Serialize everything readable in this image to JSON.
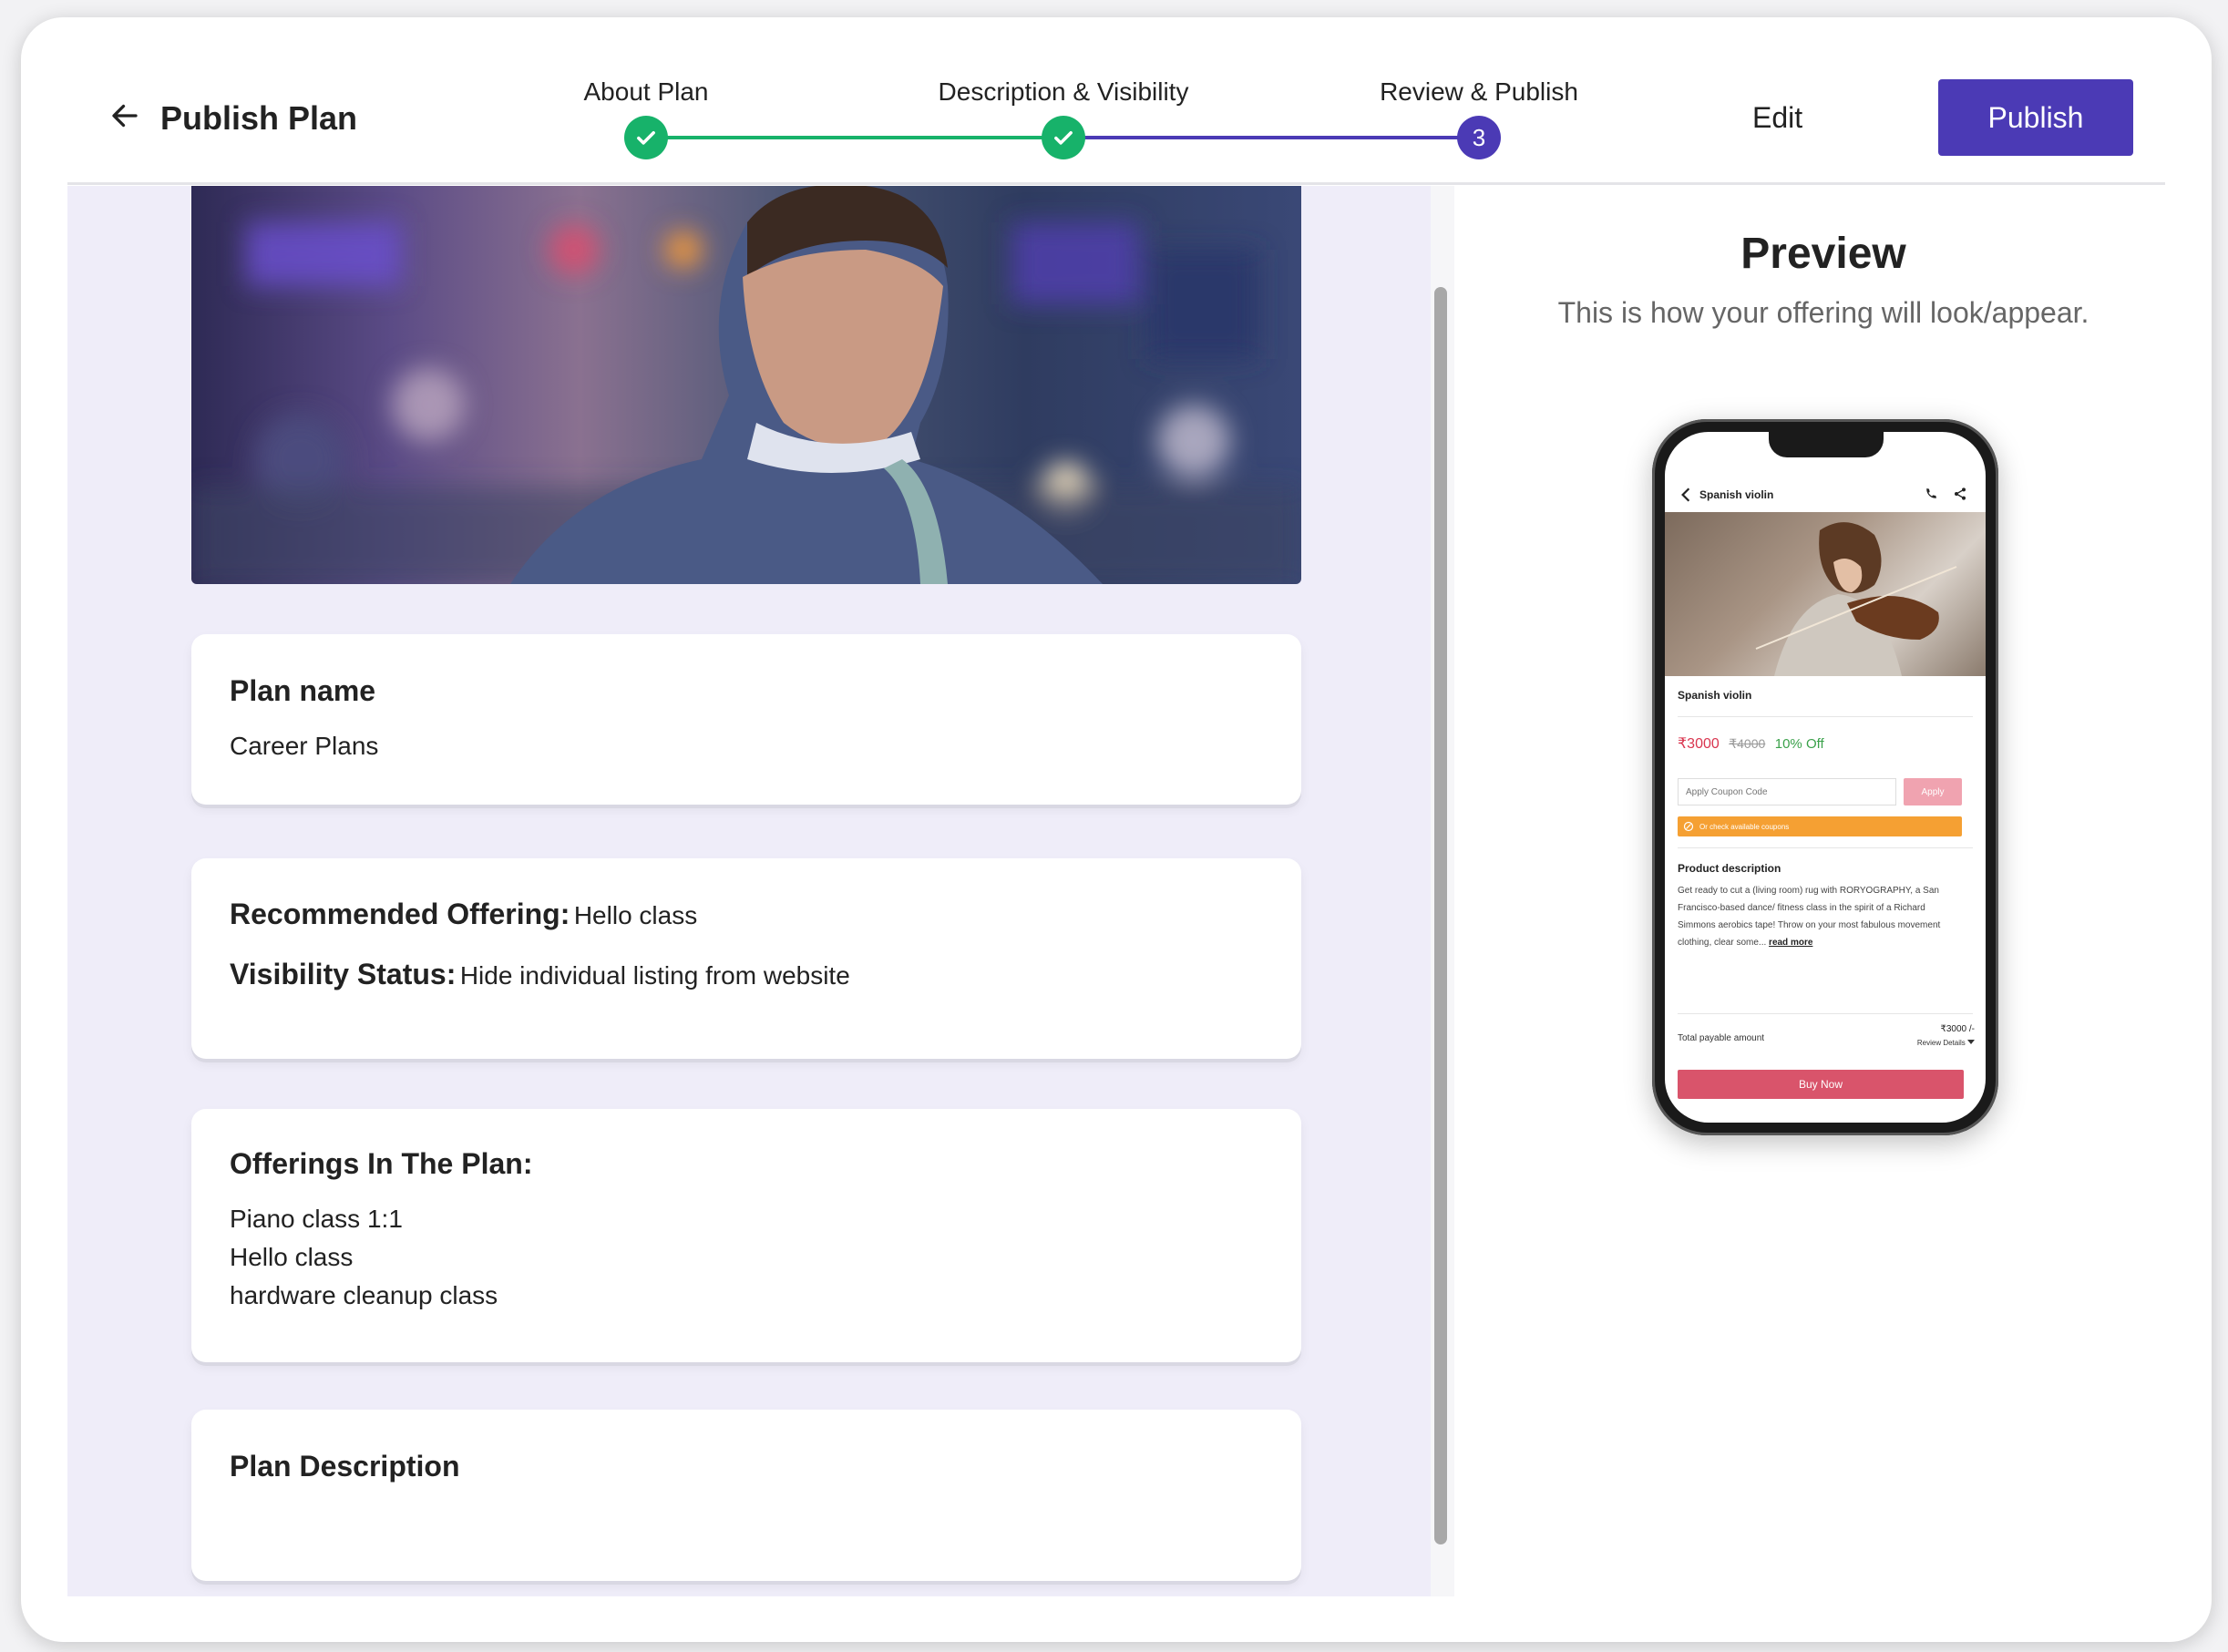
{
  "header": {
    "title": "Publish Plan",
    "steps": [
      {
        "label": "About Plan",
        "status": "done"
      },
      {
        "label": "Description & Visibility",
        "status": "done"
      },
      {
        "label": "Review & Publish",
        "status": "current",
        "number": "3"
      }
    ],
    "edit_label": "Edit",
    "publish_label": "Publish"
  },
  "cards": {
    "plan_name": {
      "title": "Plan name",
      "value": "Career Plans"
    },
    "details": {
      "recommended_label": "Recommended Offering:",
      "recommended_value": "Hello class",
      "visibility_label": "Visibility Status:",
      "visibility_value": "Hide individual listing from website"
    },
    "offerings": {
      "title": "Offerings In The Plan:",
      "items": [
        "Piano class 1:1",
        "Hello class",
        "hardware cleanup class"
      ]
    },
    "description": {
      "title": "Plan Description"
    }
  },
  "preview": {
    "title": "Preview",
    "subtitle": "This is how your offering will look/appear.",
    "phone": {
      "topbar_title": "Spanish violin",
      "product_name": "Spanish violin",
      "price": "₹3000",
      "old_price": "₹4000",
      "discount": "10% Off",
      "coupon_placeholder": "Apply Coupon Code",
      "apply_label": "Apply",
      "coupons_banner": "Or check available coupons",
      "desc_title": "Product description",
      "desc_text": "Get ready to cut a (living room) rug with RORYOGRAPHY, a San Francisco-based dance/ fitness class in the spirit of a Richard Simmons aerobics tape! Throw on your most fabulous movement clothing, clear some...",
      "read_more": "read more",
      "total_label": "Total payable amount",
      "total_value": "₹3000 /-",
      "review_details": "Review Details",
      "buy_now": "Buy Now"
    }
  },
  "colors": {
    "primary": "#4b3ab5",
    "success": "#17b26a",
    "panel_bg": "#efedf9",
    "buy_button": "#d9546b",
    "coupon_banner": "#f5a033"
  }
}
